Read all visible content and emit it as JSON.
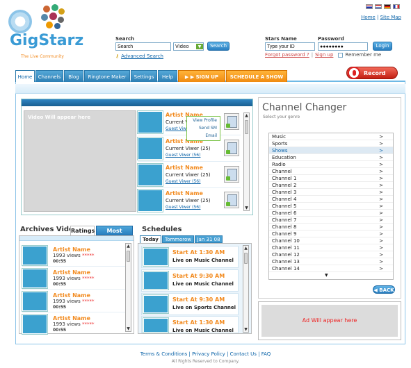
{
  "logo": {
    "brand": "GigStarz",
    "tagline": "The Live Community"
  },
  "top_links": {
    "home": "Home",
    "sep": "|",
    "sitemap": "Site Map"
  },
  "search": {
    "label": "Search",
    "value": "Search",
    "type_value": "Video",
    "button": "Search",
    "advanced": "Advanced Search"
  },
  "login": {
    "stars_label": "Stars Name",
    "password_label": "Password",
    "id_value": "Type your ID",
    "password_value": "●●●●●●●●",
    "button": "Login",
    "forgot": "Forgot password ?",
    "signup": "Sign up",
    "remember": "Remember me"
  },
  "nav": {
    "tabs": [
      {
        "label": "Home"
      },
      {
        "label": "Channels"
      },
      {
        "label": "Blog"
      },
      {
        "label": "Ringtone Maker"
      },
      {
        "label": "Settings"
      },
      {
        "label": "Help"
      }
    ],
    "signup": "▶ ▶ SIGN UP",
    "schedule": "SCHEDULE A SHOW",
    "record": "Record Now"
  },
  "video": {
    "placeholder": "Video Will appear here",
    "artists": [
      {
        "name": "Artist Name",
        "current": "Current Viwer (25)",
        "guest": "Guest Viwer (56)"
      },
      {
        "name": "Artist Name",
        "current": "Current Viwer (25)",
        "guest": "Guest Viwer (56)"
      },
      {
        "name": "Artist Name",
        "current": "Current Viwer (25)",
        "guest": "Guest Viwer (56)"
      },
      {
        "name": "Artist Name",
        "current": "Current Viwer (25)",
        "guest": "Guest Viwer (56)"
      }
    ],
    "popup": [
      "View Profile",
      "Send SM",
      "Email"
    ]
  },
  "channel_changer": {
    "title": "Channel Changer",
    "subtitle": "Select your genre",
    "items": [
      "Music",
      "Sports",
      "Shows",
      "Education",
      "Radio",
      "Channel",
      "Channel 1",
      "Channel 2",
      "Channel 3",
      "Channel 4",
      "Channel 5",
      "Channel 6",
      "Channel 7",
      "Channel 8",
      "Channel 9",
      "Channel 10",
      "Channel 11",
      "Channel 12",
      "Channel 13",
      "Channel 14"
    ],
    "arrow": ">",
    "selected": "Shows",
    "back": "BACK"
  },
  "ad": {
    "text": "Ad Will appear here"
  },
  "archives": {
    "title": "Archives Videos",
    "tabs": [
      "Ratings",
      "Most Viewed"
    ],
    "items": [
      {
        "name": "Artist Name",
        "views": "1993 views",
        "stars": "*****",
        "time": "00:55"
      },
      {
        "name": "Artist Name",
        "views": "1993 views",
        "stars": "*****",
        "time": "00:55"
      },
      {
        "name": "Artist Name",
        "views": "1993 views",
        "stars": "*****",
        "time": "00:55"
      },
      {
        "name": "Artist Name",
        "views": "1993 views",
        "stars": "*****",
        "time": "00:55"
      }
    ]
  },
  "schedules": {
    "title": "Schedules",
    "tabs": [
      "Today",
      "Tommorow",
      "Jan 31 08"
    ],
    "items": [
      {
        "start": "Start At 1:30 AM",
        "live": "Live on Music Channel"
      },
      {
        "start": "Start At 9:30 AM",
        "live": "Live on Music Channel"
      },
      {
        "start": "Start At 9:30 AM",
        "live": "Live on Sports Channel"
      },
      {
        "start": "Start At 1:30 AM",
        "live": "Live on Music Channel"
      }
    ]
  },
  "footer": {
    "links": [
      "Terms & Conditions",
      "Privacy Policy",
      "Contact Us",
      "FAQ"
    ],
    "sep": "|",
    "copyright": "All Rights Reserved to Company."
  },
  "colors": {
    "accent": "#2a7fc0",
    "orange": "#f28a1e",
    "red": "#c21f12",
    "thumb": "#3ba1cf"
  }
}
